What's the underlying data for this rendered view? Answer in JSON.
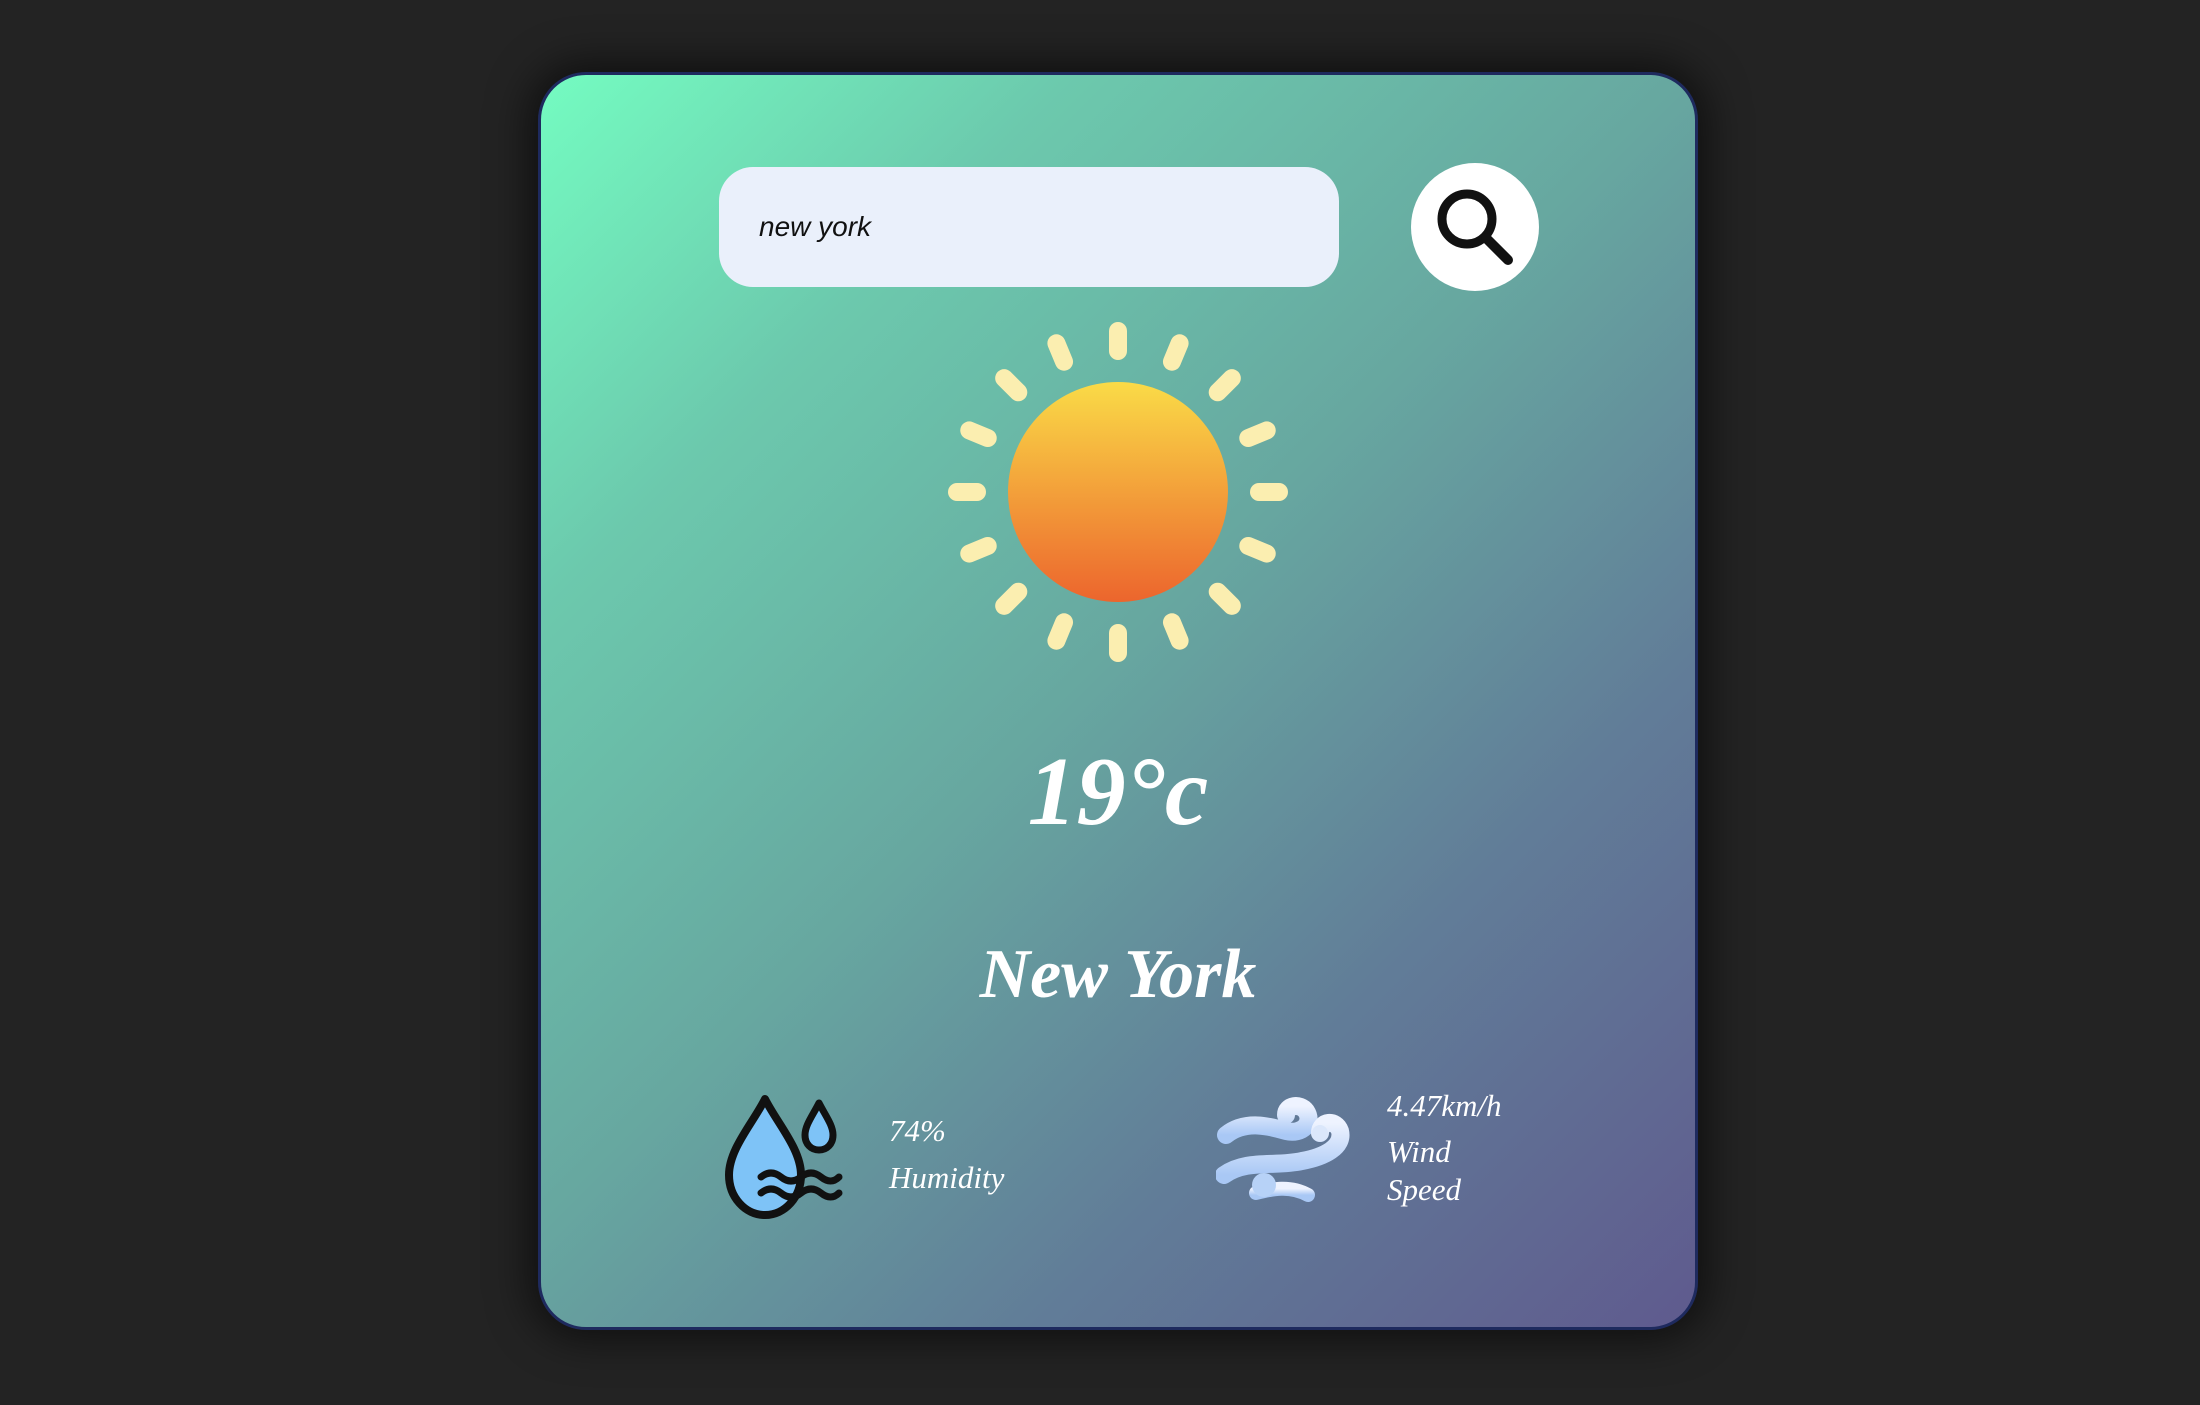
{
  "search": {
    "value": "new york",
    "placeholder": ""
  },
  "weather": {
    "icon": "sun-icon",
    "temperature": "19°c",
    "city": "New York"
  },
  "details": {
    "humidity": {
      "icon": "humidity-icon",
      "value": "74%",
      "label": "Humidity"
    },
    "wind": {
      "icon": "wind-icon",
      "value": "4.47km/h",
      "label": "Wind Speed"
    }
  },
  "colors": {
    "page_background": "#232323",
    "card_gradient": [
      "#74fcc1",
      "#67a7a0",
      "#5f5a8e"
    ],
    "input_background": "#eaf0fb",
    "sun_top": "#fadb47",
    "sun_bottom": "#ec652d",
    "sun_rays": "#fbeeb0"
  }
}
